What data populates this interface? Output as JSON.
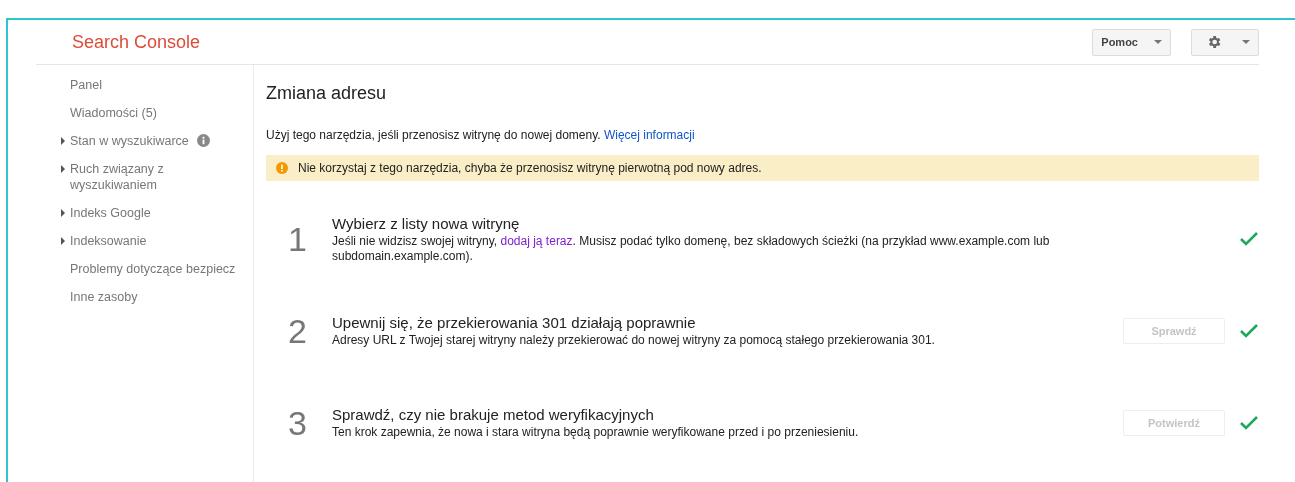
{
  "header": {
    "logo": "Search Console",
    "help_menu": {
      "label": "Pomoc"
    }
  },
  "sidebar": {
    "items": [
      {
        "label": "Panel",
        "expandable": false,
        "info": false
      },
      {
        "label": "Wiadomości (5)",
        "expandable": false,
        "info": false
      },
      {
        "label": "Stan w wyszukiwarce",
        "expandable": true,
        "info": true
      },
      {
        "label": "Ruch związany z wyszukiwaniem",
        "expandable": true,
        "info": false
      },
      {
        "label": "Indeks Google",
        "expandable": true,
        "info": false
      },
      {
        "label": "Indeksowanie",
        "expandable": true,
        "info": false
      },
      {
        "label": "Problemy dotyczące bezpiecz",
        "expandable": false,
        "info": false
      },
      {
        "label": "Inne zasoby",
        "expandable": false,
        "info": false
      }
    ]
  },
  "page": {
    "title": "Zmiana adresu",
    "intro": [
      {
        "text": "Użyj tego narzędzia, jeśli przenosisz witrynę do nowej domeny. ",
        "link": false
      },
      {
        "text": "Więcej informacji",
        "link": true
      }
    ],
    "warning": "Nie korzystaj z tego narzędzia, chyba że przenosisz witrynę pierwotną pod nowy adres.",
    "steps": [
      {
        "number": "1",
        "title": "Wybierz z listy nowa witrynę",
        "done": true,
        "description": [
          {
            "text": "Jeśli nie widzisz swojej witryny, ",
            "link": false
          },
          {
            "text": "dodaj ją teraz",
            "link": true
          },
          {
            "text": ". Musisz podać tylko domenę, bez składowych ścieżki (na przykład www.example.com lub subdomain.example.com).",
            "link": false
          }
        ]
      },
      {
        "number": "2",
        "title": "Upewnij się, że przekierowania 301 działają poprawnie",
        "done": true,
        "button": {
          "label": "Sprawdź",
          "disabled": true
        },
        "description": [
          {
            "text": "Adresy URL z Twojej starej witryny należy przekierować do nowej witryny za pomocą stałego przekierowania 301.",
            "link": false
          }
        ]
      },
      {
        "number": "3",
        "title": "Sprawdź, czy nie brakuje metod weryfikacyjnych",
        "done": true,
        "button": {
          "label": "Potwierdź",
          "disabled": true
        },
        "description": [
          {
            "text": "Ten krok zapewnia, że nowa i stara witryna będą poprawnie weryfikowane przed i po przeniesieniu.",
            "link": false
          }
        ]
      }
    ]
  }
}
